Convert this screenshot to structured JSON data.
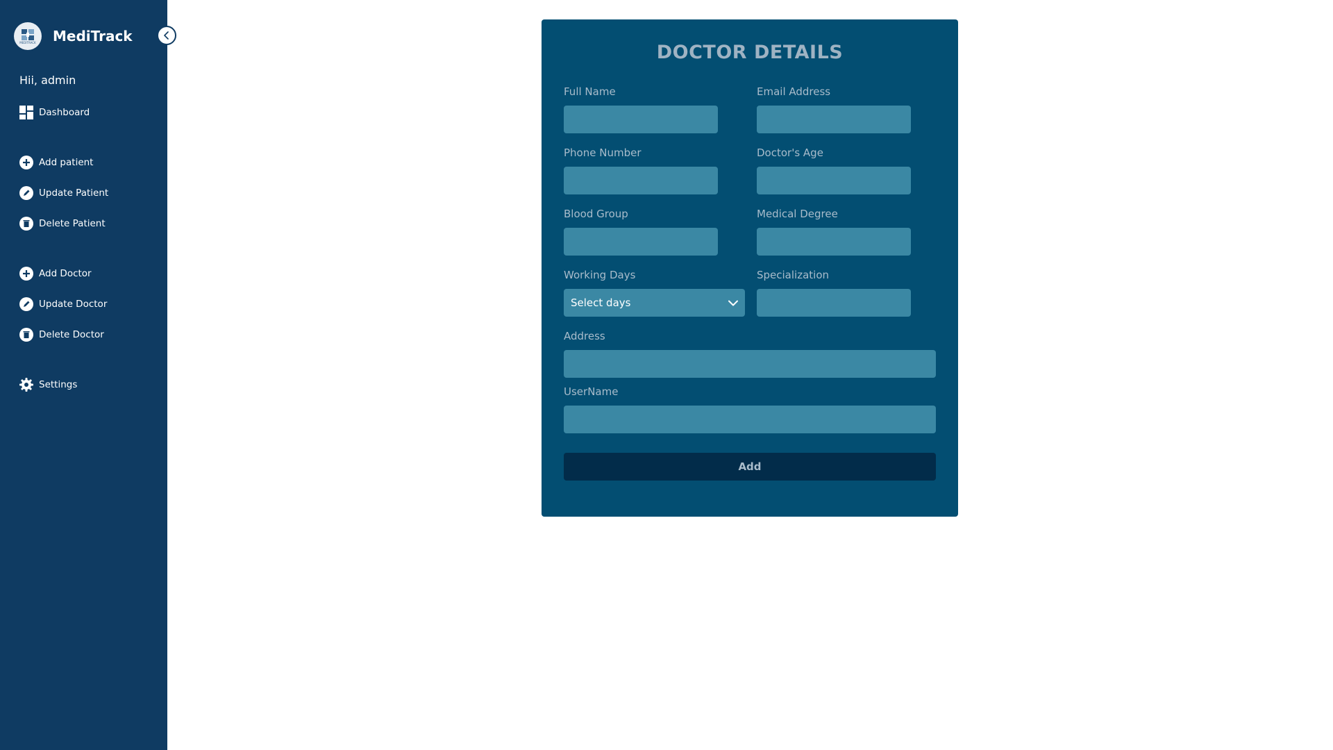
{
  "app": {
    "brand_name": "MediTrack",
    "logo_text": "MEDITRACK",
    "greeting": "Hii, admin"
  },
  "sidebar": {
    "items": [
      {
        "label": "Dashboard",
        "icon": "dashboard-icon"
      },
      {
        "label": "Add patient",
        "icon": "plus-circle-icon"
      },
      {
        "label": "Update Patient",
        "icon": "pencil-circle-icon"
      },
      {
        "label": "Delete Patient",
        "icon": "trash-circle-icon"
      },
      {
        "label": "Add Doctor",
        "icon": "plus-circle-icon"
      },
      {
        "label": "Update Doctor",
        "icon": "pencil-circle-icon"
      },
      {
        "label": "Delete Doctor",
        "icon": "trash-circle-icon"
      },
      {
        "label": "Settings",
        "icon": "gear-icon"
      }
    ]
  },
  "form": {
    "title": "DOCTOR DETAILS",
    "fields": {
      "full_name": {
        "label": "Full Name",
        "value": ""
      },
      "email": {
        "label": "Email Address",
        "value": ""
      },
      "phone": {
        "label": "Phone Number",
        "value": ""
      },
      "age": {
        "label": "Doctor's Age",
        "value": ""
      },
      "blood_group": {
        "label": "Blood Group",
        "value": ""
      },
      "degree": {
        "label": "Medical Degree",
        "value": ""
      },
      "working_days": {
        "label": "Working Days",
        "value": "Select days"
      },
      "specialization": {
        "label": "Specialization",
        "value": ""
      },
      "address": {
        "label": "Address",
        "value": ""
      },
      "username": {
        "label": "UserName",
        "value": ""
      }
    },
    "submit_label": "Add"
  },
  "colors": {
    "sidebar_bg": "#0f3b62",
    "card_bg": "#034e72",
    "input_bg": "#3b88a4",
    "button_bg": "#022c4a",
    "label_text": "#a9bccb"
  }
}
